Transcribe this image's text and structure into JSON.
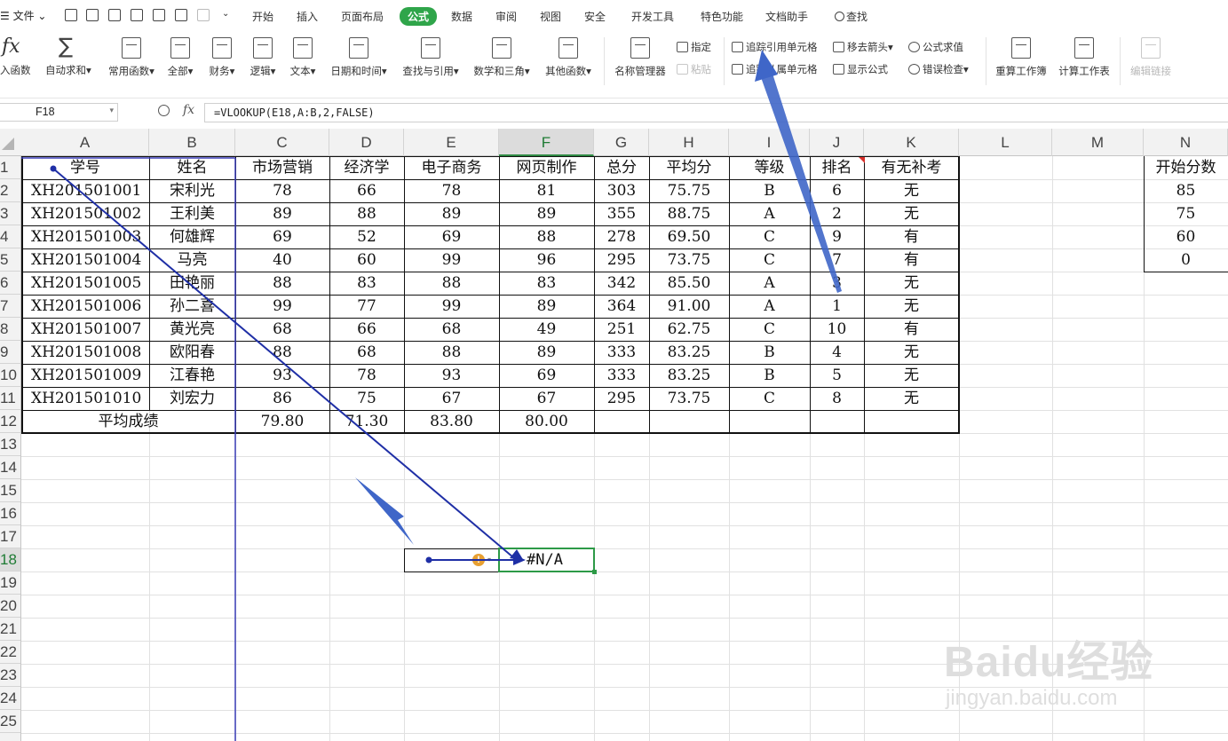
{
  "menubar": {
    "file_label": "☰ 文件 ⌄",
    "tabs": [
      {
        "label": "开始",
        "active": false
      },
      {
        "label": "插入",
        "active": false
      },
      {
        "label": "页面布局",
        "active": false
      },
      {
        "label": "公式",
        "active": true
      },
      {
        "label": "数据",
        "active": false
      },
      {
        "label": "审阅",
        "active": false
      },
      {
        "label": "视图",
        "active": false
      },
      {
        "label": "安全",
        "active": false
      },
      {
        "label": "开发工具",
        "active": false
      },
      {
        "label": "特色功能",
        "active": false
      },
      {
        "label": "文档助手",
        "active": false
      }
    ],
    "search_label": "查找",
    "active_color": "#2fa54a"
  },
  "ribbon": {
    "insert_function": "入函数",
    "autosum": "自动求和▾",
    "groups": [
      "常用函数▾",
      "全部▾",
      "财务▾",
      "逻辑▾",
      "文本▾",
      "日期和时间▾",
      "查找与引用▾",
      "数学和三角▾",
      "其他函数▾"
    ],
    "name_manager": "名称管理器",
    "define": "指定",
    "paste": "粘贴",
    "trace_precedents": "追踪引用单元格",
    "trace_dependents": "追踪从属单元格",
    "remove_arrows": "移去箭头▾",
    "show_formulas": "显示公式",
    "evaluate": "公式求值",
    "error_check": "错误检查▾",
    "recalc_workbook": "重算工作簿",
    "calc_sheet": "计算工作表",
    "edit_links": "编辑链接"
  },
  "formula_bar": {
    "name_box": "F18",
    "formula": "=VLOOKUP(E18,A:B,2,FALSE)"
  },
  "sheet": {
    "columns": [
      "A",
      "B",
      "C",
      "D",
      "E",
      "F",
      "G",
      "H",
      "I",
      "J",
      "K",
      "L",
      "M",
      "N"
    ],
    "selected_column": "F",
    "visible_row_labels": [
      "1",
      "2",
      "3",
      "4",
      "5",
      "6",
      "7",
      "8",
      "9",
      "10",
      "11",
      "12",
      "13",
      "14",
      "15",
      "16",
      "17",
      "18",
      "19",
      "20",
      "21",
      "22",
      "23",
      "24",
      "25"
    ],
    "selected_row": "18",
    "header": [
      "学号",
      "姓名",
      "市场营销",
      "经济学",
      "电子商务",
      "网页制作",
      "总分",
      "平均分",
      "等级",
      "排名",
      "有无补考"
    ],
    "rows": [
      [
        "XH201501001",
        "宋利光",
        "78",
        "66",
        "78",
        "81",
        "303",
        "75.75",
        "B",
        "6",
        "无"
      ],
      [
        "XH201501002",
        "王利美",
        "89",
        "88",
        "89",
        "89",
        "355",
        "88.75",
        "A",
        "2",
        "无"
      ],
      [
        "XH201501003",
        "何雄辉",
        "69",
        "52",
        "69",
        "88",
        "278",
        "69.50",
        "C",
        "9",
        "有"
      ],
      [
        "XH201501004",
        "马亮",
        "40",
        "60",
        "99",
        "96",
        "295",
        "73.75",
        "C",
        "7",
        "有"
      ],
      [
        "XH201501005",
        "田艳丽",
        "88",
        "83",
        "88",
        "83",
        "342",
        "85.50",
        "A",
        "3",
        "无"
      ],
      [
        "XH201501006",
        "孙二喜",
        "99",
        "77",
        "99",
        "89",
        "364",
        "91.00",
        "A",
        "1",
        "无"
      ],
      [
        "XH201501007",
        "黄光亮",
        "68",
        "66",
        "68",
        "49",
        "251",
        "62.75",
        "C",
        "10",
        "有"
      ],
      [
        "XH201501008",
        "欧阳春",
        "88",
        "68",
        "88",
        "89",
        "333",
        "83.25",
        "B",
        "4",
        "无"
      ],
      [
        "XH201501009",
        "江春艳",
        "93",
        "78",
        "93",
        "69",
        "333",
        "83.25",
        "B",
        "5",
        "无"
      ],
      [
        "XH201501010",
        "刘宏力",
        "86",
        "75",
        "67",
        "67",
        "295",
        "73.75",
        "C",
        "8",
        "无"
      ]
    ],
    "average_label": "平均成绩",
    "averages": [
      "79.80",
      "71.30",
      "83.80",
      "80.00"
    ],
    "side_table": {
      "header": "开始分数",
      "values": [
        "85",
        "75",
        "60",
        "0"
      ]
    },
    "f18_value": "#N/A",
    "error_badge": "!"
  },
  "watermark": {
    "brand": "Baidu经验",
    "url": "jingyan.baidu.com"
  },
  "colors": {
    "trace_arrow": "#1f2fa6",
    "callout_arrow": "#3f66c8",
    "selection": "#2d9a47"
  }
}
